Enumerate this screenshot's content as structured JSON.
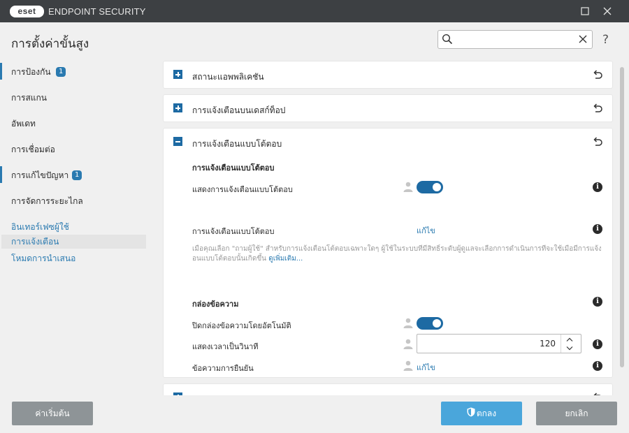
{
  "window": {
    "logo_text": "eset",
    "app_name": "ENDPOINT SECURITY",
    "maximize_icon": "maximize-icon",
    "close_icon": "close-icon"
  },
  "header": {
    "title": "การตั้งค่าขั้นสูง",
    "search_value": "",
    "help_label": "?"
  },
  "sidebar": {
    "items": [
      {
        "label": "การป้องกัน",
        "badge": "1"
      },
      {
        "label": "การสแกน"
      },
      {
        "label": "อัพเดท"
      },
      {
        "label": "การเชื่อมต่อ"
      },
      {
        "label": "การแก้ไขปัญหา",
        "badge": "1"
      },
      {
        "label": "การจัดการระยะไกล"
      }
    ],
    "ui_group": {
      "title": "อินเทอร์เฟซผู้ใช้",
      "children": [
        "การแจ้งเตือน",
        "โหมดการนำเสนอ"
      ]
    }
  },
  "cards": [
    {
      "title": "สถานะแอพพลิเคชัน",
      "expanded": false
    },
    {
      "title": "การแจ้งเตือนบนเดสก์ท็อป",
      "expanded": false
    },
    {
      "title": "การแจ้งเตือนแบบโต้ตอบ",
      "expanded": true,
      "section1_title": "การแจ้งเตือนแบบโต้ตอบ",
      "show_interactive_label": "แสดงการแจ้งเตือนแบบโต้ตอบ",
      "show_interactive_on": true,
      "interactive_alerts_label": "การแจ้งเตือนแบบโต้ตอบ",
      "edit_link": "แก้ไข",
      "description": "เมื่อคุณเลือก \"ถามผู้ใช้\" สำหรับการแจ้งเตือนโต้ตอบเฉพาะใดๆ ผู้ใช้ในระบบที่มีสิทธิ์ระดับผู้ดูแลจะเลือกการดำเนินการที่จะใช้เมื่อมีการแจ้งเต",
      "description_line2": "อนแบบโต้ตอบนั้นเกิดขึ้น",
      "learn_more": "ดูเพิ่มเติม...",
      "section2_title": "กล่องข้อความ",
      "auto_close_label": "ปิดกล่องข้อความโดยอัตโนมัติ",
      "auto_close_on": true,
      "timeout_label": "แสดงเวลาเป็นวินาที",
      "timeout_value": "120",
      "confirm_label": "ข้อความการยืนยัน",
      "confirm_edit_link": "แก้ไข"
    }
  ],
  "footer": {
    "default_label": "ค่าเริ่มต้น",
    "ok_label": "ตกลง",
    "cancel_label": "ยกเลิก"
  },
  "colors": {
    "titlebar": "#3d4043",
    "accent": "#1d6aa3",
    "link": "#2a7ab0",
    "ok_button": "#4aa6db",
    "gray_button": "#8e9497"
  }
}
